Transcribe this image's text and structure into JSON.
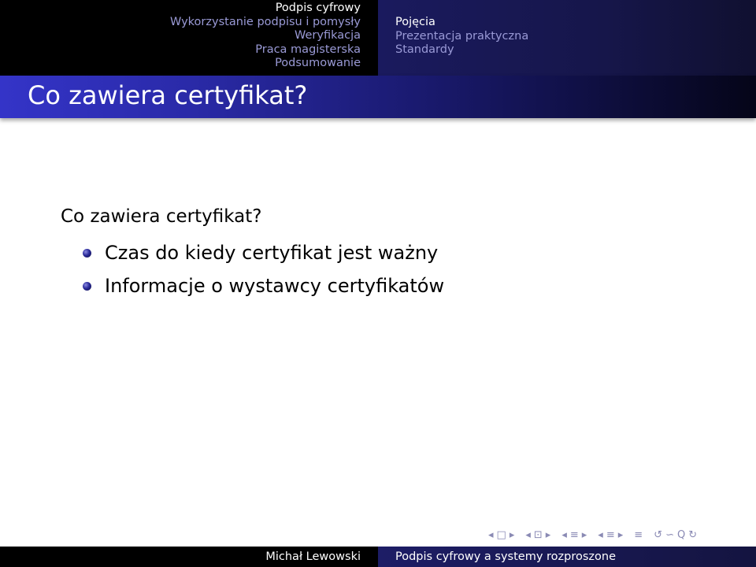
{
  "header": {
    "sections": [
      {
        "label": "Podpis cyfrowy",
        "active": true
      },
      {
        "label": "Wykorzystanie podpisu i pomysły",
        "active": false
      },
      {
        "label": "Weryfikacja",
        "active": false
      },
      {
        "label": "Praca magisterska",
        "active": false
      },
      {
        "label": "Podsumowanie",
        "active": false
      }
    ],
    "subsections": [
      {
        "label": "Pojęcia",
        "active": true
      },
      {
        "label": "Prezentacja praktyczna",
        "active": false
      },
      {
        "label": "Standardy",
        "active": false
      }
    ]
  },
  "frame": {
    "title": "Co zawiera certyfikat?",
    "intro": "Co zawiera certyfikat?",
    "bullets": [
      "Czas do kiedy certyfikat jest ważny",
      "Informacje o wystawcy certyfikatów"
    ]
  },
  "nav_symbols": {
    "items": [
      "◂",
      "□",
      "▸",
      "◂",
      "⊡",
      "▸",
      "◂",
      "≡",
      "▸",
      "◂",
      "≡",
      "▸",
      "≡",
      "↺",
      "∽",
      "Q",
      "↻"
    ]
  },
  "footer": {
    "author": "Michał Lewowski",
    "title": "Podpis cyfrowy a systemy rozproszone"
  },
  "colors": {
    "header_left": "#000000",
    "header_right": "#1a1a5e",
    "title_bar": "#3434c8",
    "inactive_nav": "#9a9ad6"
  }
}
